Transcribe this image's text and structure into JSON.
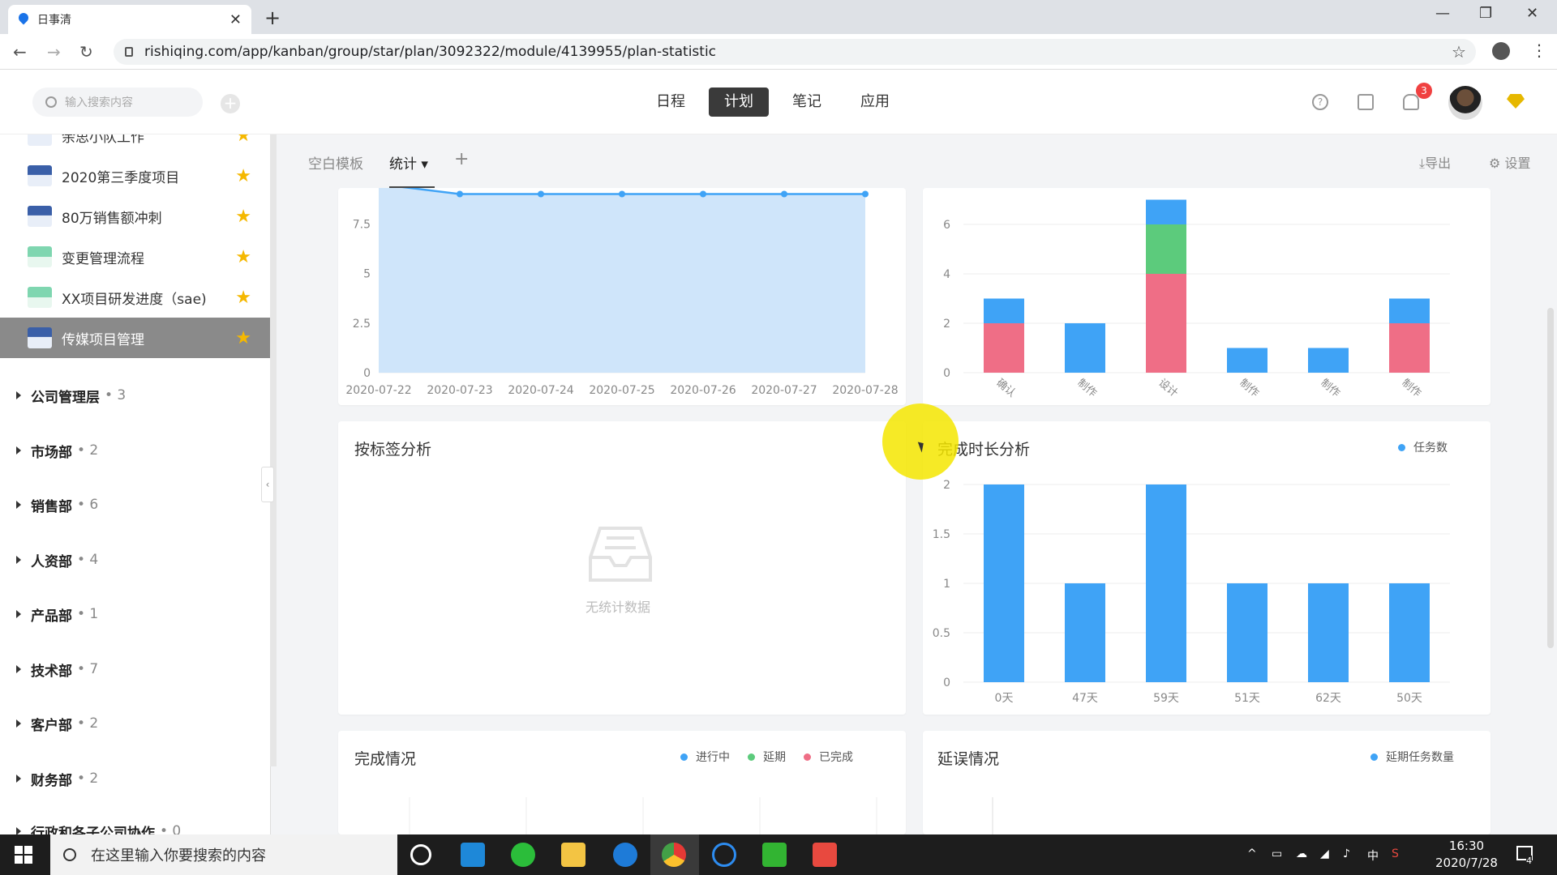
{
  "browser": {
    "tab_title": "日事清",
    "url": "rishiqing.com/app/kanban/group/star/plan/3092322/module/4139955/plan-statistic"
  },
  "header": {
    "search_placeholder": "输入搜索内容",
    "nav": [
      "日程",
      "计划",
      "笔记",
      "应用"
    ],
    "active_nav": "计划",
    "notification_count": "3"
  },
  "sidebar": {
    "plans": [
      {
        "label": "余思小队工作",
        "thumb": "blue"
      },
      {
        "label": "2020第三季度项目",
        "thumb": "blue"
      },
      {
        "label": "80万销售额冲刺",
        "thumb": "blue"
      },
      {
        "label": "变更管理流程",
        "thumb": "green"
      },
      {
        "label": "XX项目研发进度（sae)",
        "thumb": "green"
      },
      {
        "label": "传媒项目管理",
        "thumb": "blue",
        "selected": true
      }
    ],
    "groups": [
      {
        "name": "公司管理层",
        "count": "• 3"
      },
      {
        "name": "市场部",
        "count": "• 2"
      },
      {
        "name": "销售部",
        "count": "• 6"
      },
      {
        "name": "人资部",
        "count": "• 4"
      },
      {
        "name": "产品部",
        "count": "• 1"
      },
      {
        "name": "技术部",
        "count": "• 7"
      },
      {
        "name": "客户部",
        "count": "• 2"
      },
      {
        "name": "财务部",
        "count": "• 2"
      },
      {
        "name": "行政和各子公司协作",
        "count": "• 0"
      }
    ]
  },
  "viewbar": {
    "tabs": [
      "空白模板",
      "统计",
      "+"
    ],
    "export_label": "导出",
    "settings_label": "设置"
  },
  "panels": {
    "tag_analysis": {
      "title": "按标签分析",
      "empty_text": "无统计数据"
    },
    "duration_analysis": {
      "title": "完成时长分析",
      "legend": [
        "任务数"
      ]
    },
    "completion": {
      "title": "完成情况",
      "legend": [
        "进行中",
        "延期",
        "已完成"
      ]
    },
    "delay": {
      "title": "延误情况",
      "legend": [
        "延期任务数量"
      ]
    }
  },
  "colors": {
    "blue": "#3fa3f6",
    "green": "#5ccb7c",
    "red": "#ef6e86",
    "area_fill": "#cfe5fa"
  },
  "chart_data": [
    {
      "type": "area",
      "x": [
        "2020-07-22",
        "2020-07-23",
        "2020-07-24",
        "2020-07-25",
        "2020-07-26",
        "2020-07-27",
        "2020-07-28"
      ],
      "values": [
        9.5,
        9,
        9,
        9,
        9,
        9,
        9
      ],
      "yticks": [
        "0",
        "2.5",
        "5",
        "7.5"
      ],
      "ylim": [
        0,
        9.5
      ]
    },
    {
      "type": "bar",
      "categories": [
        "确认",
        "制作",
        "设计",
        "制作",
        "制作",
        "制作"
      ],
      "series": [
        {
          "color": "red",
          "values": [
            2,
            0,
            4,
            0,
            0,
            2
          ]
        },
        {
          "color": "green",
          "values": [
            0,
            0,
            2,
            0,
            0,
            0
          ]
        },
        {
          "color": "blue",
          "values": [
            1,
            2,
            1,
            1,
            1,
            1
          ]
        }
      ],
      "yticks": [
        "0",
        "2",
        "4",
        "6"
      ],
      "ylim": [
        0,
        7
      ]
    },
    {
      "type": "bar",
      "title": "完成时长分析",
      "categories": [
        "0天",
        "47天",
        "59天",
        "51天",
        "62天",
        "50天"
      ],
      "series": [
        {
          "name": "任务数",
          "values": [
            2,
            1,
            2,
            1,
            1,
            1
          ]
        }
      ],
      "yticks": [
        "0",
        "0.5",
        "1",
        "1.5",
        "2"
      ],
      "ylim": [
        0,
        2
      ]
    }
  ],
  "taskbar": {
    "search_placeholder": "在这里输入你要搜索的内容",
    "ime": "中",
    "time": "16:30",
    "date": "2020/7/28",
    "notification_count": "4"
  }
}
